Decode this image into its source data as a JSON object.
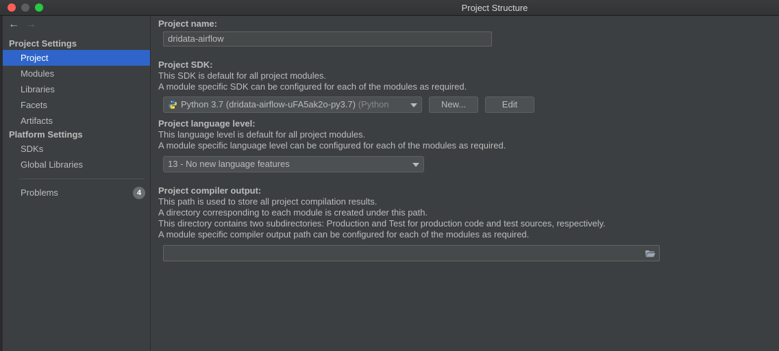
{
  "window": {
    "title": "Project Structure"
  },
  "sidebar": {
    "project_settings_header": "Project Settings",
    "project_items": [
      "Project",
      "Modules",
      "Libraries",
      "Facets",
      "Artifacts"
    ],
    "platform_settings_header": "Platform Settings",
    "platform_items": [
      "SDKs",
      "Global Libraries"
    ],
    "problems_label": "Problems",
    "problems_count": "4",
    "selected": "Project"
  },
  "main": {
    "project_name": {
      "label": "Project name:",
      "value": "dridata-airflow"
    },
    "project_sdk": {
      "label": "Project SDK:",
      "desc1": "This SDK is default for all project modules.",
      "desc2": "A module specific SDK can be configured for each of the modules as required.",
      "selected_value": "Python 3.7 (dridata-airflow-uFA5ak2o-py3.7)",
      "selected_suffix": "(Python",
      "new_button": "New...",
      "edit_button": "Edit"
    },
    "language_level": {
      "label": "Project language level:",
      "desc1": "This language level is default for all project modules.",
      "desc2": "A module specific language level can be configured for each of the modules as required.",
      "selected_value": "13 - No new language features"
    },
    "compiler_output": {
      "label": "Project compiler output:",
      "desc1": "This path is used to store all project compilation results.",
      "desc2": "A directory corresponding to each module is created under this path.",
      "desc3": "This directory contains two subdirectories: Production and Test for production code and test sources, respectively.",
      "desc4": "A module specific compiler output path can be configured for each of the modules as required.",
      "path_value": ""
    }
  },
  "colors": {
    "selection": "#2f65ca",
    "panel_bg": "#3c3f41",
    "close": "#fe5f57",
    "maximize": "#28c840"
  }
}
